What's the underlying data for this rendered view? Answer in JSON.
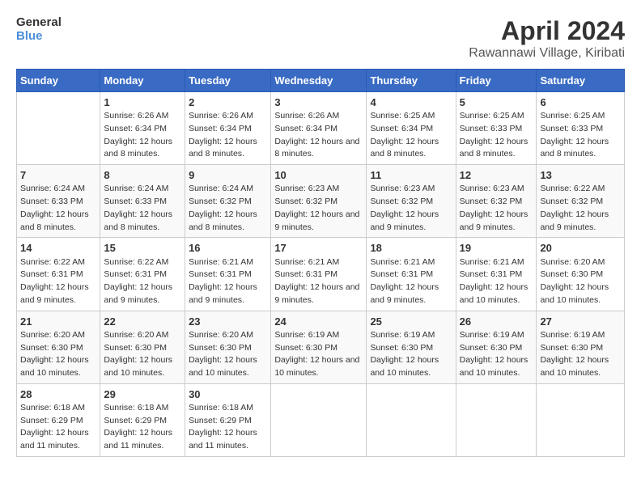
{
  "logo": {
    "line1": "General",
    "line2": "Blue"
  },
  "title": "April 2024",
  "subtitle": "Rawannawi Village, Kiribati",
  "days_of_week": [
    "Sunday",
    "Monday",
    "Tuesday",
    "Wednesday",
    "Thursday",
    "Friday",
    "Saturday"
  ],
  "weeks": [
    [
      {
        "day": "",
        "sunrise": "",
        "sunset": "",
        "daylight": ""
      },
      {
        "day": "1",
        "sunrise": "Sunrise: 6:26 AM",
        "sunset": "Sunset: 6:34 PM",
        "daylight": "Daylight: 12 hours and 8 minutes."
      },
      {
        "day": "2",
        "sunrise": "Sunrise: 6:26 AM",
        "sunset": "Sunset: 6:34 PM",
        "daylight": "Daylight: 12 hours and 8 minutes."
      },
      {
        "day": "3",
        "sunrise": "Sunrise: 6:26 AM",
        "sunset": "Sunset: 6:34 PM",
        "daylight": "Daylight: 12 hours and 8 minutes."
      },
      {
        "day": "4",
        "sunrise": "Sunrise: 6:25 AM",
        "sunset": "Sunset: 6:34 PM",
        "daylight": "Daylight: 12 hours and 8 minutes."
      },
      {
        "day": "5",
        "sunrise": "Sunrise: 6:25 AM",
        "sunset": "Sunset: 6:33 PM",
        "daylight": "Daylight: 12 hours and 8 minutes."
      },
      {
        "day": "6",
        "sunrise": "Sunrise: 6:25 AM",
        "sunset": "Sunset: 6:33 PM",
        "daylight": "Daylight: 12 hours and 8 minutes."
      }
    ],
    [
      {
        "day": "7",
        "sunrise": "Sunrise: 6:24 AM",
        "sunset": "Sunset: 6:33 PM",
        "daylight": "Daylight: 12 hours and 8 minutes."
      },
      {
        "day": "8",
        "sunrise": "Sunrise: 6:24 AM",
        "sunset": "Sunset: 6:33 PM",
        "daylight": "Daylight: 12 hours and 8 minutes."
      },
      {
        "day": "9",
        "sunrise": "Sunrise: 6:24 AM",
        "sunset": "Sunset: 6:32 PM",
        "daylight": "Daylight: 12 hours and 8 minutes."
      },
      {
        "day": "10",
        "sunrise": "Sunrise: 6:23 AM",
        "sunset": "Sunset: 6:32 PM",
        "daylight": "Daylight: 12 hours and 9 minutes."
      },
      {
        "day": "11",
        "sunrise": "Sunrise: 6:23 AM",
        "sunset": "Sunset: 6:32 PM",
        "daylight": "Daylight: 12 hours and 9 minutes."
      },
      {
        "day": "12",
        "sunrise": "Sunrise: 6:23 AM",
        "sunset": "Sunset: 6:32 PM",
        "daylight": "Daylight: 12 hours and 9 minutes."
      },
      {
        "day": "13",
        "sunrise": "Sunrise: 6:22 AM",
        "sunset": "Sunset: 6:32 PM",
        "daylight": "Daylight: 12 hours and 9 minutes."
      }
    ],
    [
      {
        "day": "14",
        "sunrise": "Sunrise: 6:22 AM",
        "sunset": "Sunset: 6:31 PM",
        "daylight": "Daylight: 12 hours and 9 minutes."
      },
      {
        "day": "15",
        "sunrise": "Sunrise: 6:22 AM",
        "sunset": "Sunset: 6:31 PM",
        "daylight": "Daylight: 12 hours and 9 minutes."
      },
      {
        "day": "16",
        "sunrise": "Sunrise: 6:21 AM",
        "sunset": "Sunset: 6:31 PM",
        "daylight": "Daylight: 12 hours and 9 minutes."
      },
      {
        "day": "17",
        "sunrise": "Sunrise: 6:21 AM",
        "sunset": "Sunset: 6:31 PM",
        "daylight": "Daylight: 12 hours and 9 minutes."
      },
      {
        "day": "18",
        "sunrise": "Sunrise: 6:21 AM",
        "sunset": "Sunset: 6:31 PM",
        "daylight": "Daylight: 12 hours and 9 minutes."
      },
      {
        "day": "19",
        "sunrise": "Sunrise: 6:21 AM",
        "sunset": "Sunset: 6:31 PM",
        "daylight": "Daylight: 12 hours and 10 minutes."
      },
      {
        "day": "20",
        "sunrise": "Sunrise: 6:20 AM",
        "sunset": "Sunset: 6:30 PM",
        "daylight": "Daylight: 12 hours and 10 minutes."
      }
    ],
    [
      {
        "day": "21",
        "sunrise": "Sunrise: 6:20 AM",
        "sunset": "Sunset: 6:30 PM",
        "daylight": "Daylight: 12 hours and 10 minutes."
      },
      {
        "day": "22",
        "sunrise": "Sunrise: 6:20 AM",
        "sunset": "Sunset: 6:30 PM",
        "daylight": "Daylight: 12 hours and 10 minutes."
      },
      {
        "day": "23",
        "sunrise": "Sunrise: 6:20 AM",
        "sunset": "Sunset: 6:30 PM",
        "daylight": "Daylight: 12 hours and 10 minutes."
      },
      {
        "day": "24",
        "sunrise": "Sunrise: 6:19 AM",
        "sunset": "Sunset: 6:30 PM",
        "daylight": "Daylight: 12 hours and 10 minutes."
      },
      {
        "day": "25",
        "sunrise": "Sunrise: 6:19 AM",
        "sunset": "Sunset: 6:30 PM",
        "daylight": "Daylight: 12 hours and 10 minutes."
      },
      {
        "day": "26",
        "sunrise": "Sunrise: 6:19 AM",
        "sunset": "Sunset: 6:30 PM",
        "daylight": "Daylight: 12 hours and 10 minutes."
      },
      {
        "day": "27",
        "sunrise": "Sunrise: 6:19 AM",
        "sunset": "Sunset: 6:30 PM",
        "daylight": "Daylight: 12 hours and 10 minutes."
      }
    ],
    [
      {
        "day": "28",
        "sunrise": "Sunrise: 6:18 AM",
        "sunset": "Sunset: 6:29 PM",
        "daylight": "Daylight: 12 hours and 11 minutes."
      },
      {
        "day": "29",
        "sunrise": "Sunrise: 6:18 AM",
        "sunset": "Sunset: 6:29 PM",
        "daylight": "Daylight: 12 hours and 11 minutes."
      },
      {
        "day": "30",
        "sunrise": "Sunrise: 6:18 AM",
        "sunset": "Sunset: 6:29 PM",
        "daylight": "Daylight: 12 hours and 11 minutes."
      },
      {
        "day": "",
        "sunrise": "",
        "sunset": "",
        "daylight": ""
      },
      {
        "day": "",
        "sunrise": "",
        "sunset": "",
        "daylight": ""
      },
      {
        "day": "",
        "sunrise": "",
        "sunset": "",
        "daylight": ""
      },
      {
        "day": "",
        "sunrise": "",
        "sunset": "",
        "daylight": ""
      }
    ]
  ]
}
